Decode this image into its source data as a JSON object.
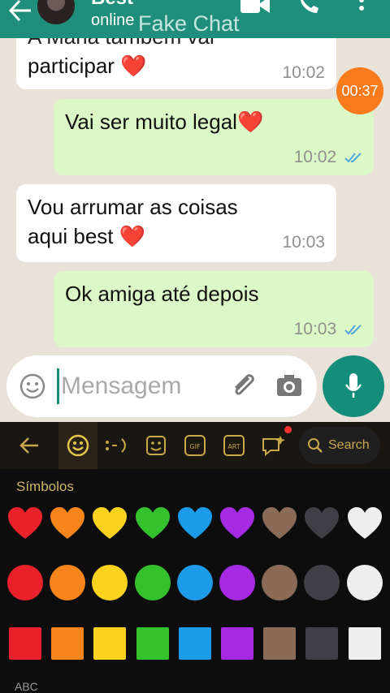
{
  "header": {
    "contact_name": "Best",
    "contact_status": "online",
    "watermark": "Fake Chat",
    "bg_color": "#1f8f7b"
  },
  "chat": {
    "timer": "00:37",
    "messages": [
      {
        "direction": "in",
        "lines": [
          "A Maria também vai",
          "participar ❤️"
        ],
        "time": "10:02"
      },
      {
        "direction": "out",
        "lines": [
          "Vai ser muito legal❤️"
        ],
        "time": "10:02",
        "read": true
      },
      {
        "direction": "in",
        "lines": [
          "Vou arrumar as coisas",
          "aqui best ❤️"
        ],
        "time": "10:03"
      },
      {
        "direction": "out",
        "lines": [
          "Ok amiga até depois"
        ],
        "time": "10:03",
        "read": true
      }
    ]
  },
  "composer": {
    "placeholder": "Mensagem",
    "value": ""
  },
  "keyboard": {
    "search_label": "Search",
    "section_title": "Símbolos",
    "bottom_label": "ABC",
    "tabs": [
      "back-arrow-icon",
      "smiley-icon",
      "emoticon-icon",
      "sticker-icon",
      "gif-icon",
      "art-icon",
      "combo-icon"
    ],
    "colors": [
      "#e8212b",
      "#f7851c",
      "#fbd21d",
      "#35c12e",
      "#1b9be8",
      "#a72ae3",
      "#8c6a58",
      "#3f3f45",
      "#eeeeee"
    ]
  }
}
